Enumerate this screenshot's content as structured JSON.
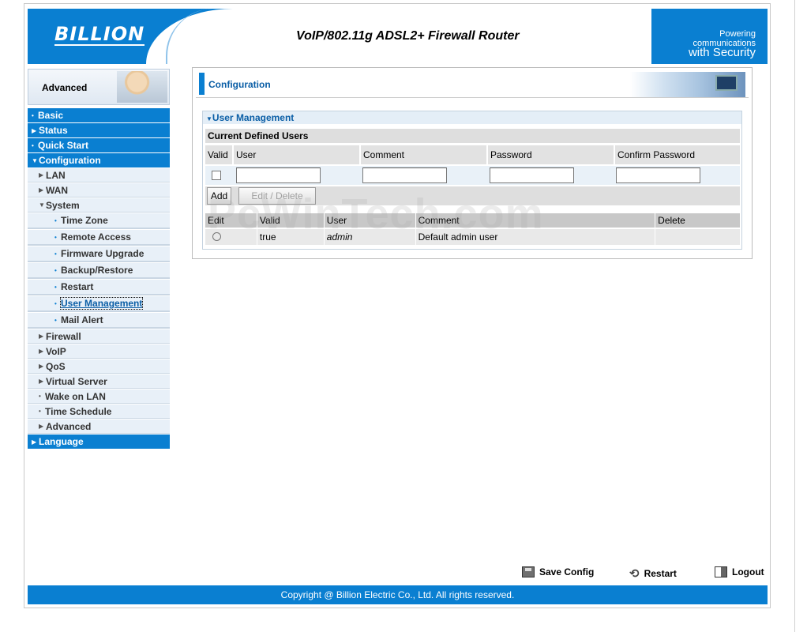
{
  "header": {
    "logo": "BILLION",
    "title": "VoIP/802.11g ADSL2+ Firewall Router",
    "tagline_top": "Powering communications",
    "tagline_bottom": "with Security"
  },
  "sidebar": {
    "mode_label": "Advanced",
    "items": [
      {
        "label": "Basic"
      },
      {
        "label": "Status"
      },
      {
        "label": "Quick Start"
      },
      {
        "label": "Configuration"
      },
      {
        "label": "LAN"
      },
      {
        "label": "WAN"
      },
      {
        "label": "System"
      },
      {
        "label": "Time Zone"
      },
      {
        "label": "Remote Access"
      },
      {
        "label": "Firmware Upgrade"
      },
      {
        "label": "Backup/Restore"
      },
      {
        "label": "Restart"
      },
      {
        "label": "User Management"
      },
      {
        "label": "Mail Alert"
      },
      {
        "label": "Firewall"
      },
      {
        "label": "VoIP"
      },
      {
        "label": "QoS"
      },
      {
        "label": "Virtual Server"
      },
      {
        "label": "Wake on LAN"
      },
      {
        "label": "Time Schedule"
      },
      {
        "label": "Advanced"
      },
      {
        "label": "Language"
      }
    ]
  },
  "main": {
    "section_title": "Configuration",
    "panel_title": "User Management",
    "subheader": "Current Defined Users",
    "form_headers": [
      "Valid",
      "User",
      "Comment",
      "Password",
      "Confirm Password"
    ],
    "buttons": {
      "add": "Add",
      "edit_delete": "Edit / Delete"
    },
    "list_headers": [
      "Edit",
      "Valid",
      "User",
      "Comment",
      "Delete"
    ],
    "rows": [
      {
        "valid": "true",
        "user": "admin",
        "comment": "Default admin user"
      }
    ]
  },
  "watermark": "PcWinTech.com",
  "toolbar": {
    "save": "Save Config",
    "restart": "Restart",
    "logout": "Logout"
  },
  "footer": {
    "copyright": "Copyright @ Billion Electric Co., Ltd. All rights reserved."
  },
  "colors": {
    "brand_blue": "#0a7fd1",
    "link_blue": "#0a5ea6"
  },
  "icons": [
    "save-config-icon",
    "restart-icon",
    "logout-icon",
    "chevron-down-icon",
    "chevron-right-icon"
  ]
}
